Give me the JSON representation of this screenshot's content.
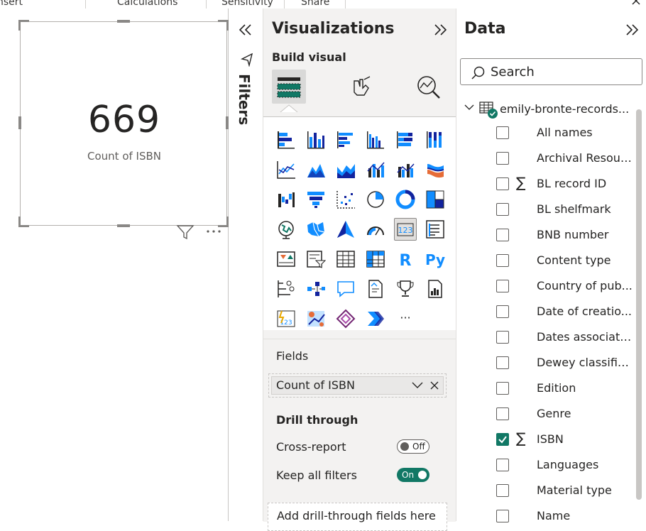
{
  "ribbon": {
    "tabs": [
      "nsert",
      "Calculations",
      "Sensitivity",
      "Share"
    ]
  },
  "card": {
    "value": "669",
    "label": "Count of ISBN"
  },
  "filters_pane": {
    "label": "Filters"
  },
  "visualizations": {
    "title": "Visualizations",
    "build_visual_label": "Build visual",
    "tabs": [
      "build-visual-icon",
      "format-visual-icon",
      "analytics-icon"
    ],
    "gallery_icons": [
      "stacked-bar-chart-icon",
      "stacked-column-chart-icon",
      "clustered-bar-chart-icon",
      "clustered-column-chart-icon",
      "100-stacked-bar-chart-icon",
      "100-stacked-column-chart-icon",
      "line-chart-icon",
      "area-chart-icon",
      "stacked-area-chart-icon",
      "line-and-stacked-column-icon",
      "line-and-clustered-column-icon",
      "ribbon-chart-icon",
      "waterfall-chart-icon",
      "funnel-icon",
      "scatter-chart-icon",
      "pie-chart-icon",
      "donut-chart-icon",
      "treemap-icon",
      "map-icon",
      "filled-map-icon",
      "azure-map-icon",
      "gauge-icon",
      "card-icon",
      "multi-row-card-icon",
      "kpi-icon",
      "slicer-icon",
      "table-icon",
      "matrix-icon",
      "r-visual-icon",
      "python-visual-icon",
      "key-influencers-icon",
      "decomposition-tree-icon",
      "qa-icon",
      "smart-narrative-icon",
      "metrics-icon",
      "paginated-report-icon",
      "power-apps-icon",
      "arcgis-map-icon",
      "power-apps-diamond-icon",
      "power-automate-icon",
      "more-visuals-icon"
    ],
    "gallery_text": {
      "r": "R",
      "py": "Py",
      "more": "···",
      "card": "123"
    },
    "fields_label": "Fields",
    "field_value": "Count of ISBN",
    "drill_through_label": "Drill through",
    "cross_report_label": "Cross-report",
    "cross_report_state": "Off",
    "keep_filters_label": "Keep all filters",
    "keep_filters_state": "On",
    "drill_placeholder": "Add drill-through fields here"
  },
  "data_pane": {
    "title": "Data",
    "search_placeholder": "Search",
    "table_name": "emily-bronte-records...",
    "fields": [
      {
        "name": "All names",
        "checked": false,
        "sigma": false
      },
      {
        "name": "Archival Resour...",
        "checked": false,
        "sigma": false
      },
      {
        "name": "BL record ID",
        "checked": false,
        "sigma": true
      },
      {
        "name": "BL shelfmark",
        "checked": false,
        "sigma": false
      },
      {
        "name": "BNB number",
        "checked": false,
        "sigma": false
      },
      {
        "name": "Content type",
        "checked": false,
        "sigma": false
      },
      {
        "name": "Country of pub...",
        "checked": false,
        "sigma": false
      },
      {
        "name": "Date of creatio...",
        "checked": false,
        "sigma": false
      },
      {
        "name": "Dates associate...",
        "checked": false,
        "sigma": false
      },
      {
        "name": "Dewey classific...",
        "checked": false,
        "sigma": false
      },
      {
        "name": "Edition",
        "checked": false,
        "sigma": false
      },
      {
        "name": "Genre",
        "checked": false,
        "sigma": false
      },
      {
        "name": "ISBN",
        "checked": true,
        "sigma": true
      },
      {
        "name": "Languages",
        "checked": false,
        "sigma": false
      },
      {
        "name": "Material type",
        "checked": false,
        "sigma": false
      },
      {
        "name": "Name",
        "checked": false,
        "sigma": false
      }
    ],
    "sigma_glyph": "∑"
  },
  "colors": {
    "accent": "#117865",
    "chart_blue": "#118dff",
    "chart_dark": "#12239e"
  }
}
